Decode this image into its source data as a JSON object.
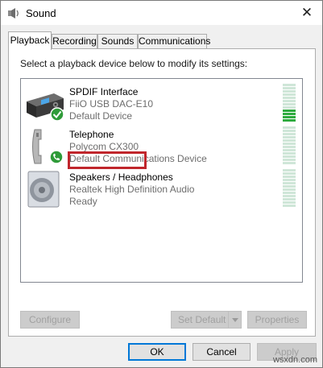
{
  "window": {
    "title": "Sound",
    "close_glyph": "✕"
  },
  "tabs": [
    {
      "label": "Playback",
      "active": true
    },
    {
      "label": "Recording",
      "active": false
    },
    {
      "label": "Sounds",
      "active": false
    },
    {
      "label": "Communications",
      "active": false
    }
  ],
  "playback": {
    "instruction": "Select a playback device below to modify its settings:",
    "devices": [
      {
        "name": "SPDIF Interface",
        "line1": "FiiO USB DAC-E10",
        "line2": "Default Device",
        "icon": "audio-interface-icon",
        "status_icon": "default-device-check-icon",
        "level_segments_lit": 4,
        "level_segments_total": 12
      },
      {
        "name": "Telephone",
        "line1": "Polycom CX300",
        "line2": "Default Communications Device",
        "icon": "telephone-icon",
        "status_icon": "communications-phone-badge-icon",
        "level_segments_lit": 0,
        "level_segments_total": 12
      },
      {
        "name": "Speakers / Headphones",
        "line1": "Realtek High Definition Audio",
        "line2": "Ready",
        "icon": "speaker-icon",
        "level_segments_lit": 0,
        "level_segments_total": 12
      }
    ]
  },
  "actions": {
    "configure": "Configure",
    "set_default": "Set Default",
    "properties": "Properties",
    "ok": "OK",
    "cancel": "Cancel",
    "apply": "Apply"
  },
  "watermark": "wsxdn.com",
  "colors": {
    "meter_lit": "#2eab3f",
    "meter_unlit": "#cfe6d8",
    "highlight": "#c0262c",
    "focus": "#0078d7"
  }
}
